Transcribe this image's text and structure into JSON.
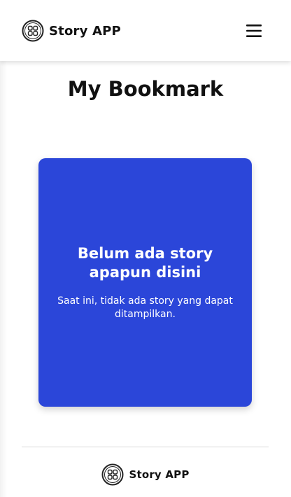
{
  "header": {
    "brand_name": "Story APP",
    "logo_icon": "story-app-logo-icon",
    "menu_icon": "hamburger-menu-icon"
  },
  "main": {
    "page_title": "My Bookmark",
    "empty_state": {
      "heading": "Belum ada story apapun disini",
      "message": "Saat ini, tidak ada story yang dapat ditampilkan."
    }
  },
  "footer": {
    "brand_name": "Story APP",
    "logo_icon": "story-app-logo-icon"
  },
  "colors": {
    "card_background": "#2b46d9",
    "text_primary": "#111111",
    "text_on_card": "#ffffff",
    "page_background": "#ffffff"
  }
}
